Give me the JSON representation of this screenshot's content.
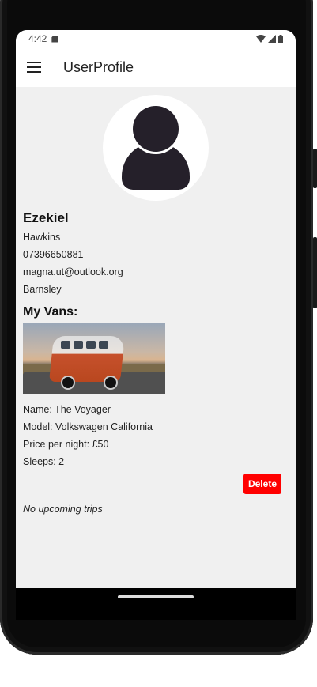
{
  "status_bar": {
    "time": "4:42"
  },
  "app_bar": {
    "title": "UserProfile"
  },
  "profile": {
    "first_name": "Ezekiel",
    "last_name": "Hawkins",
    "phone": "07396650881",
    "email": "magna.ut@outlook.org",
    "location": "Barnsley"
  },
  "vans_section": {
    "title": "My Vans:",
    "van": {
      "name": "Name: The Voyager",
      "model": "Model: Volkswagen California",
      "price": "Price per night: £50",
      "sleeps": "Sleeps: 2",
      "delete_label": "Delete"
    }
  },
  "trips": {
    "empty_message": "No upcoming trips"
  },
  "colors": {
    "delete_button": "#ff0000",
    "screen_background": "#f0f0f0",
    "app_bar": "#ffffff"
  }
}
